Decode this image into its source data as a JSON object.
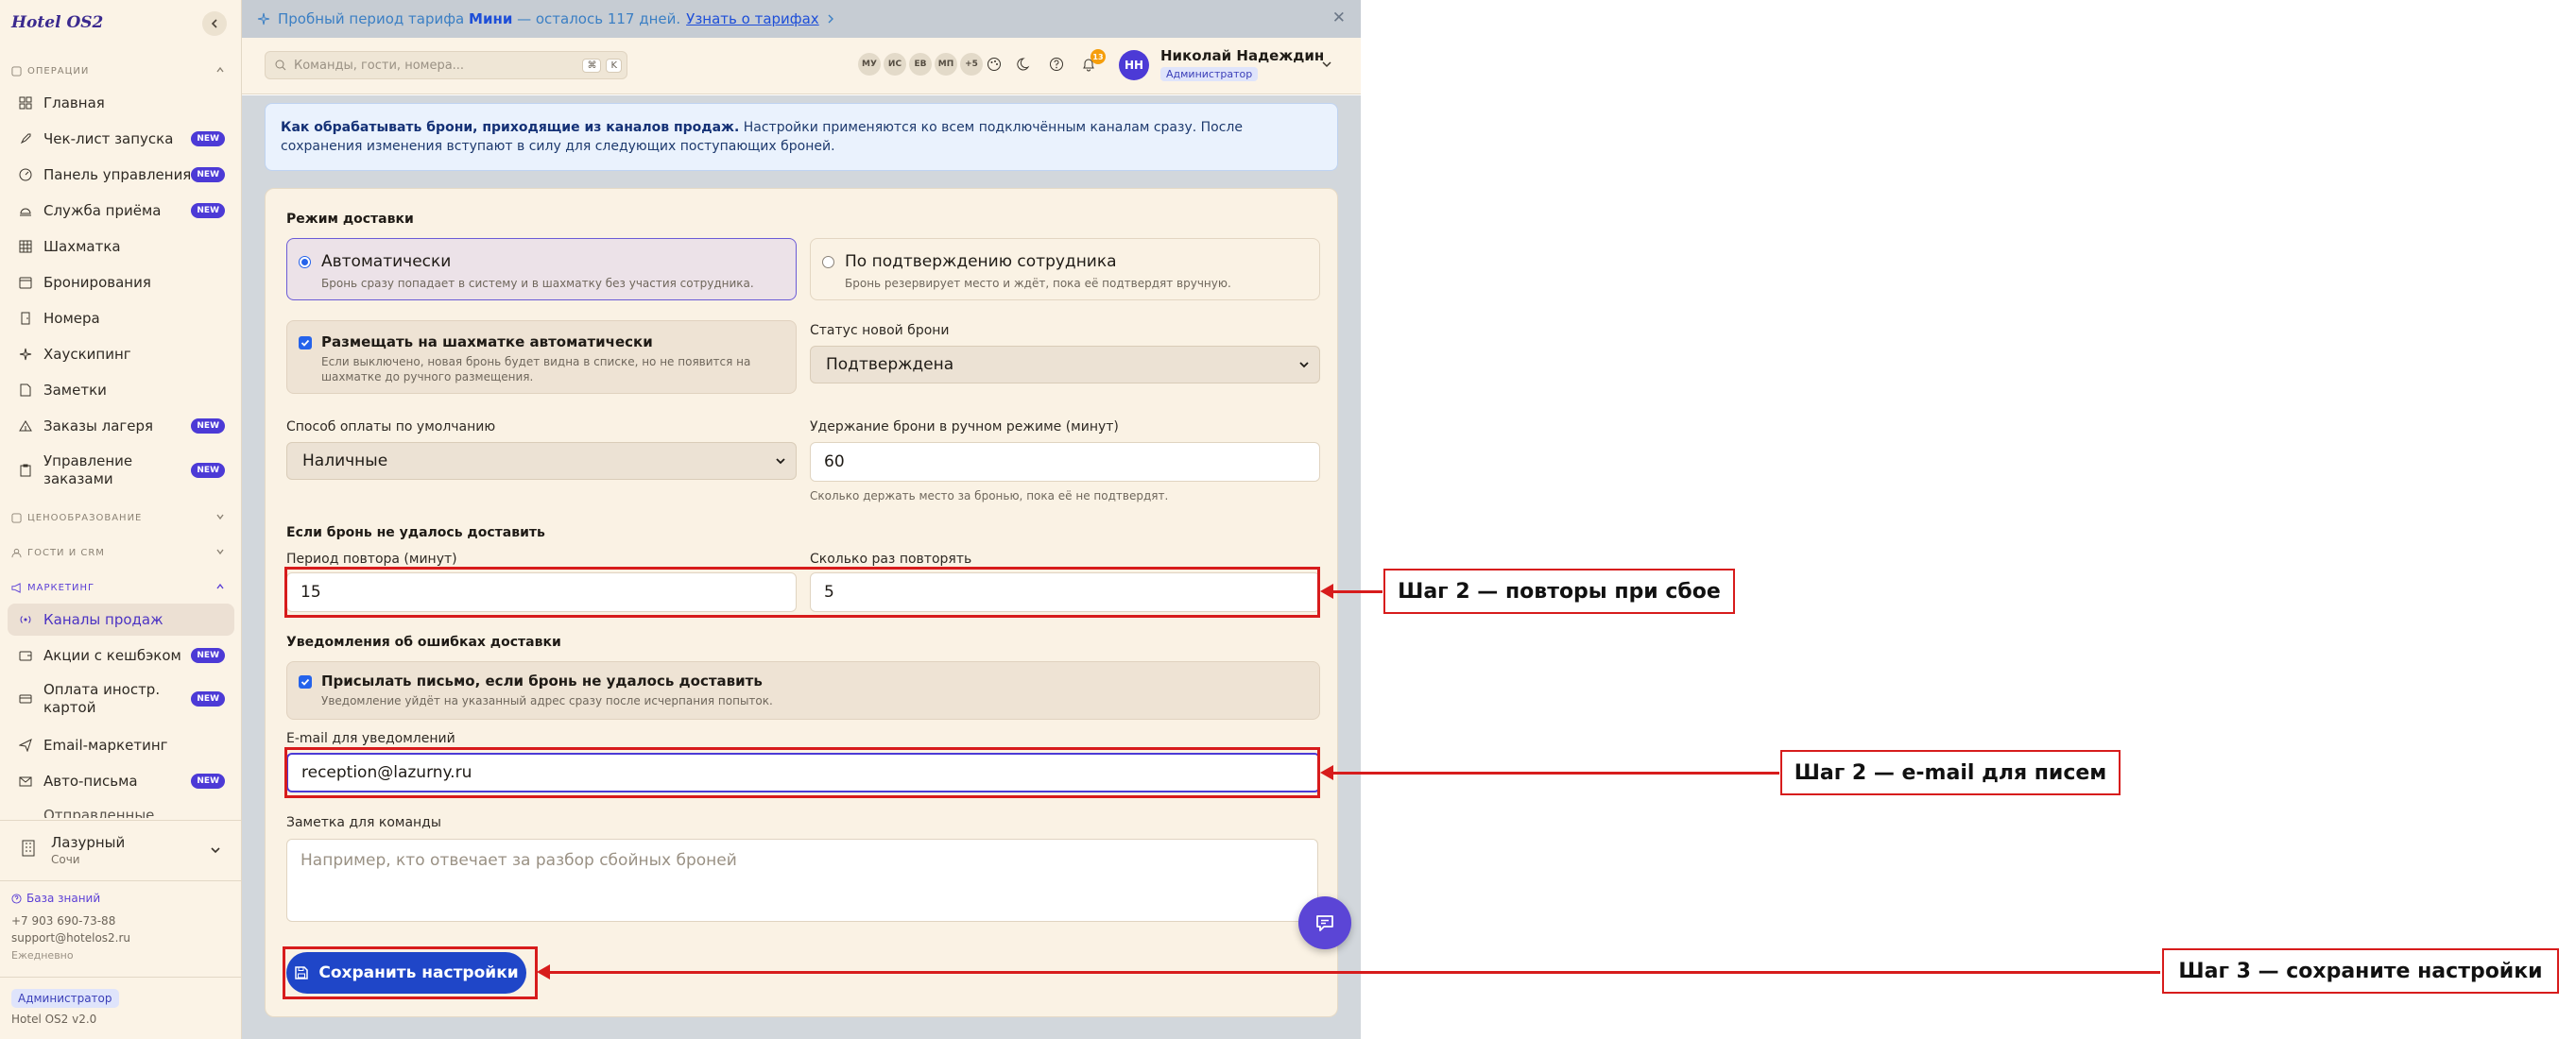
{
  "sidebar": {
    "brand": "Hotel OS2",
    "sections": {
      "operations": "ОПЕРАЦИИ",
      "pricing": "ЦЕНООБРАЗОВАНИЕ",
      "guests": "ГОСТИ И CRM",
      "marketing": "МАРКЕТИНГ"
    },
    "items": [
      {
        "label": "Главная",
        "icon": "grid-icon",
        "badge": ""
      },
      {
        "label": "Чек-лист запуска",
        "icon": "rocket-icon",
        "badge": "NEW"
      },
      {
        "label": "Панель управления",
        "icon": "gauge-icon",
        "badge": "NEW"
      },
      {
        "label": "Служба приёма",
        "icon": "bell-concierge-icon",
        "badge": "NEW"
      },
      {
        "label": "Шахматка",
        "icon": "table-grid-icon",
        "badge": ""
      },
      {
        "label": "Бронирования",
        "icon": "calendar-icon",
        "badge": ""
      },
      {
        "label": "Номера",
        "icon": "door-icon",
        "badge": ""
      },
      {
        "label": "Хаускипинг",
        "icon": "sparkle-icon",
        "badge": ""
      },
      {
        "label": "Заметки",
        "icon": "note-icon",
        "badge": ""
      },
      {
        "label": "Заказы лагеря",
        "icon": "tent-icon",
        "badge": "NEW"
      },
      {
        "label": "Управление заказами",
        "icon": "clipboard-icon",
        "badge": "NEW"
      }
    ],
    "marketing_items": [
      {
        "label": "Каналы продаж",
        "icon": "broadcast-icon",
        "badge": ""
      },
      {
        "label": "Акции с кешбэком",
        "icon": "wallet-icon",
        "badge": "NEW"
      },
      {
        "label": "Оплата иностр. картой",
        "icon": "card-icon",
        "badge": "NEW"
      },
      {
        "label": "Email-маркетинг",
        "icon": "send-icon",
        "badge": ""
      },
      {
        "label": "Авто-письма",
        "icon": "mail-icon",
        "badge": "NEW"
      },
      {
        "label": "Отправленные",
        "icon": "mail-icon",
        "badge": ""
      }
    ],
    "hotel": {
      "name": "Лазурный",
      "city": "Сочи"
    },
    "knowledge_base": "База знаний",
    "phone": "+7 903 690-73-88",
    "email": "support@hotelos2.ru",
    "schedule": "Ежедневно",
    "role": "Администратор",
    "version": "Hotel OS2 v2.0"
  },
  "trial_banner": {
    "prefix": "Пробный период тарифа ",
    "plan": "Мини",
    "suffix": " — осталось 117 дней.",
    "link": "Узнать о тарифах"
  },
  "header": {
    "search_placeholder": "Команды, гости, номера...",
    "kbd1": "⌘",
    "kbd2": "K",
    "avatars": [
      "МУ",
      "ИС",
      "ЕВ",
      "МП",
      "+5"
    ],
    "notifications_count": "13",
    "user_initials": "НН",
    "user_name": "Николай Надеждин",
    "user_role": "Администратор"
  },
  "info": {
    "bold": "Как обрабатывать брони, приходящие из каналов продаж.",
    "text": " Настройки применяются ко всем подключённым каналам сразу. После сохранения изменения вступают в силу для следующих поступающих броней."
  },
  "form": {
    "delivery_mode_label": "Режим доставки",
    "mode_auto_title": "Автоматически",
    "mode_auto_desc": "Бронь сразу попадает в систему и в шахматку без участия сотрудника.",
    "mode_manual_title": "По подтверждению сотрудника",
    "mode_manual_desc": "Бронь резервирует место и ждёт, пока её подтвердят вручную.",
    "place_auto_title": "Размещать на шахматке автоматически",
    "place_auto_desc": "Если выключено, новая бронь будет видна в списке, но не появится на шахматке до ручного размещения.",
    "status_label": "Статус новой брони",
    "status_value": "Подтверждена",
    "payment_label": "Способ оплаты по умолчанию",
    "payment_value": "Наличные",
    "hold_label": "Удержание брони в ручном режиме (минут)",
    "hold_value": "60",
    "hold_hint": "Сколько держать место за бронью, пока её не подтвердят.",
    "fail_label": "Если бронь не удалось доставить",
    "retry_period_label": "Период повтора (минут)",
    "retry_period_value": "15",
    "retry_count_label": "Сколько раз повторять",
    "retry_count_value": "5",
    "notify_label": "Уведомления об ошибках доставки",
    "notify_title": "Присылать письмо, если бронь не удалось доставить",
    "notify_desc": "Уведомление уйдёт на указанный адрес сразу после исчерпания попыток.",
    "email_label": "E-mail для уведомлений",
    "email_value": "reception@lazurny.ru",
    "note_label": "Заметка для команды",
    "note_placeholder": "Например, кто отвечает за разбор сбойных броней",
    "save_label": "Сохранить настройки"
  },
  "annotations": {
    "step_retry": "Шаг 2 — повторы при сбое",
    "step_email": "Шаг 2 — e-mail для писем",
    "step_save": "Шаг 3 — сохраните настройки"
  },
  "colors": {
    "accent": "#4c3ad6",
    "primary_button": "#1f46c8",
    "annotation_red": "#d71c1c",
    "sidebar_bg": "#fbf3e6"
  }
}
